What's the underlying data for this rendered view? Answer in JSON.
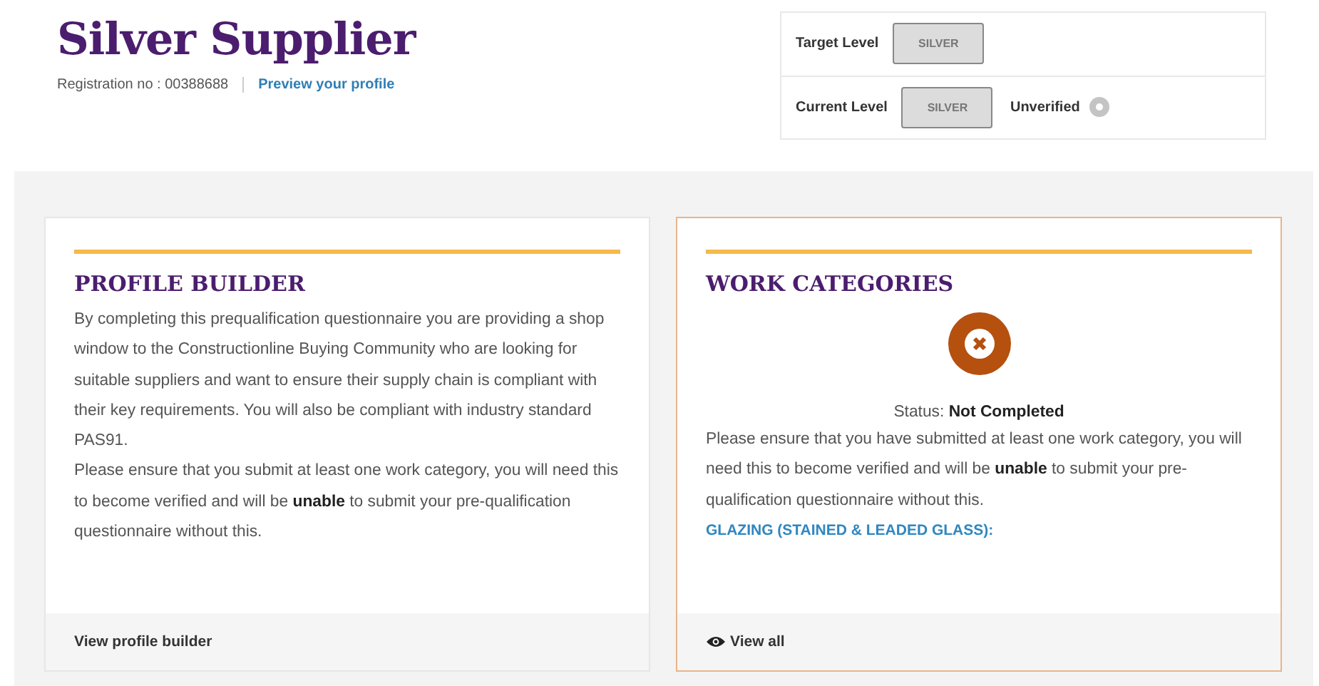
{
  "header": {
    "title": "Silver Supplier",
    "registration": "Registration no : 00388688",
    "preview_link": "Preview your profile"
  },
  "levels": [
    {
      "label": "Target Level",
      "value": "SILVER"
    },
    {
      "label": "Current Level",
      "value": "SILVER",
      "status": "Unverified",
      "verified": false
    }
  ],
  "cards": [
    {
      "kind": "text",
      "highlighted": false,
      "title": "PROFILE BUILDER",
      "paragraphs": [
        "By completing this prequalification questionnaire you are providing a shop window to the Constructionline Buying Community who are looking for suitable suppliers and want to ensure their supply chain is compliant with their key requirements. You will also be compliant with industry standard PAS91.",
        "Please ensure that you submit at least one work category, you will need this to become verified and will be **unable** to submit your pre-qualification questionnaire without this."
      ],
      "footer_link": "View profile builder",
      "footer_icon": false
    },
    {
      "kind": "status",
      "highlighted": true,
      "title": "WORK CATEGORIES",
      "completed": false,
      "status": "Status: **Not Completed**",
      "paragraphs": [
        "Please ensure that you have submitted at least one work category, you will need this to become verified and will be **unable** to submit your pre-qualification questionnaire without this."
      ],
      "category_link": "GLAZING (STAINED & LEADED GLASS):",
      "footer_link": "View all",
      "footer_icon": true
    }
  ]
}
